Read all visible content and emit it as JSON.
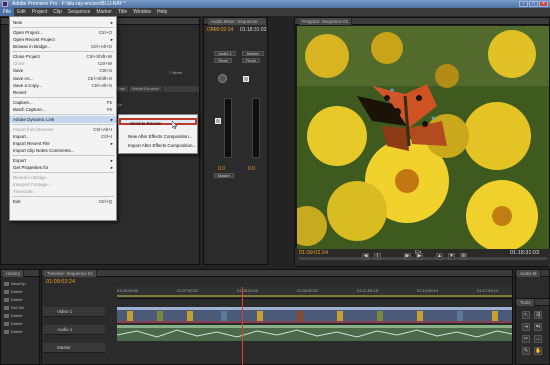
{
  "window": {
    "title": "Adobe Premiere Pro - F:\\blu-ray-encore\\BLU-RAY *"
  },
  "menubar": [
    "File",
    "Edit",
    "Project",
    "Clip",
    "Sequence",
    "Marker",
    "Title",
    "Window",
    "Help"
  ],
  "file_menu": {
    "items": [
      {
        "label": "New",
        "shortcut": "",
        "arrow": true,
        "disabled": false
      },
      {
        "label": "Open Project...",
        "shortcut": "Ctrl+O",
        "arrow": false,
        "disabled": false
      },
      {
        "label": "Open Recent Project",
        "shortcut": "",
        "arrow": true,
        "disabled": false
      },
      {
        "label": "Browse in Bridge...",
        "shortcut": "Ctrl+Alt+O",
        "arrow": false,
        "disabled": false
      },
      {
        "label": "Close Project",
        "shortcut": "Ctrl+Shift+W",
        "arrow": false,
        "disabled": false
      },
      {
        "label": "Close",
        "shortcut": "Ctrl+W",
        "arrow": false,
        "disabled": true
      },
      {
        "label": "Save",
        "shortcut": "Ctrl+S",
        "arrow": false,
        "disabled": false
      },
      {
        "label": "Save As...",
        "shortcut": "Ctrl+Shift+S",
        "arrow": false,
        "disabled": false
      },
      {
        "label": "Save a Copy...",
        "shortcut": "Ctrl+Alt+S",
        "arrow": false,
        "disabled": false
      },
      {
        "label": "Revert",
        "shortcut": "",
        "arrow": false,
        "disabled": false
      },
      {
        "label": "Capture...",
        "shortcut": "F5",
        "arrow": false,
        "disabled": false
      },
      {
        "label": "Batch Capture...",
        "shortcut": "F6",
        "arrow": false,
        "disabled": false
      },
      {
        "label": "Adobe Dynamic Link",
        "shortcut": "",
        "arrow": true,
        "disabled": false
      },
      {
        "label": "Import from Browser",
        "shortcut": "Ctrl+Alt+I",
        "arrow": false,
        "disabled": true
      },
      {
        "label": "Import...",
        "shortcut": "Ctrl+I",
        "arrow": false,
        "disabled": false
      },
      {
        "label": "Import Recent File",
        "shortcut": "",
        "arrow": true,
        "disabled": false
      },
      {
        "label": "Import Clip Notes Comments...",
        "shortcut": "",
        "arrow": false,
        "disabled": false
      },
      {
        "label": "Export",
        "shortcut": "",
        "arrow": true,
        "disabled": false
      },
      {
        "label": "Get Properties for",
        "shortcut": "",
        "arrow": true,
        "disabled": false
      },
      {
        "label": "Reveal in Bridge...",
        "shortcut": "",
        "arrow": false,
        "disabled": true
      },
      {
        "label": "Interpret Footage...",
        "shortcut": "",
        "arrow": false,
        "disabled": true
      },
      {
        "label": "Timecode...",
        "shortcut": "",
        "arrow": false,
        "disabled": true
      },
      {
        "label": "Exit",
        "shortcut": "Ctrl+Q",
        "arrow": false,
        "disabled": false
      }
    ]
  },
  "dynamic_link_submenu": [
    "Send to Encore",
    "New After Effects Composition...",
    "Import After Effects Composition..."
  ],
  "project_panel": {
    "item_count": "7 Items",
    "fps": "25 fps",
    "col_frame_rate": "Frame Rate",
    "col_media_duration": "Media Duration"
  },
  "audio_mixer": {
    "tab": "Audio Mixer: Sequence 01",
    "timecode": "01:09:02:24",
    "duration": "01:18:31:03",
    "track1": "Audio 1",
    "track2": "Master",
    "read1": "Read",
    "read2": "Read",
    "val1": "0.0",
    "val2": "0.0",
    "master_out": "Master"
  },
  "program_monitor": {
    "tab": "Program: Sequence 01",
    "timecode": "01:09:02:24",
    "duration": "01:18:31:03",
    "zoom": "Fit"
  },
  "history": {
    "tab": "History",
    "items": [
      "New/Op",
      "Delete",
      "Delete",
      "Set Sel",
      "Delete",
      "Delete",
      "Delete"
    ]
  },
  "timeline": {
    "tab": "Timeline: Sequence 01",
    "timecode": "01:09:02:24",
    "ruler_labels": [
      "01:00:00:00",
      "01:07:59:22",
      "01:05:59:20",
      "01:08:59:22",
      "01:11:59:18",
      "01:14:59:14",
      "01:17:59:14"
    ],
    "tracks": [
      "Video 1",
      "Audio 1",
      "Master"
    ]
  },
  "audio_meters_tab": "Audio M",
  "tools_tab": "Tools",
  "colors": {
    "accent": "#f0a020",
    "title_bar": "#5a7bb0",
    "highlight_border": "#c0392b"
  }
}
